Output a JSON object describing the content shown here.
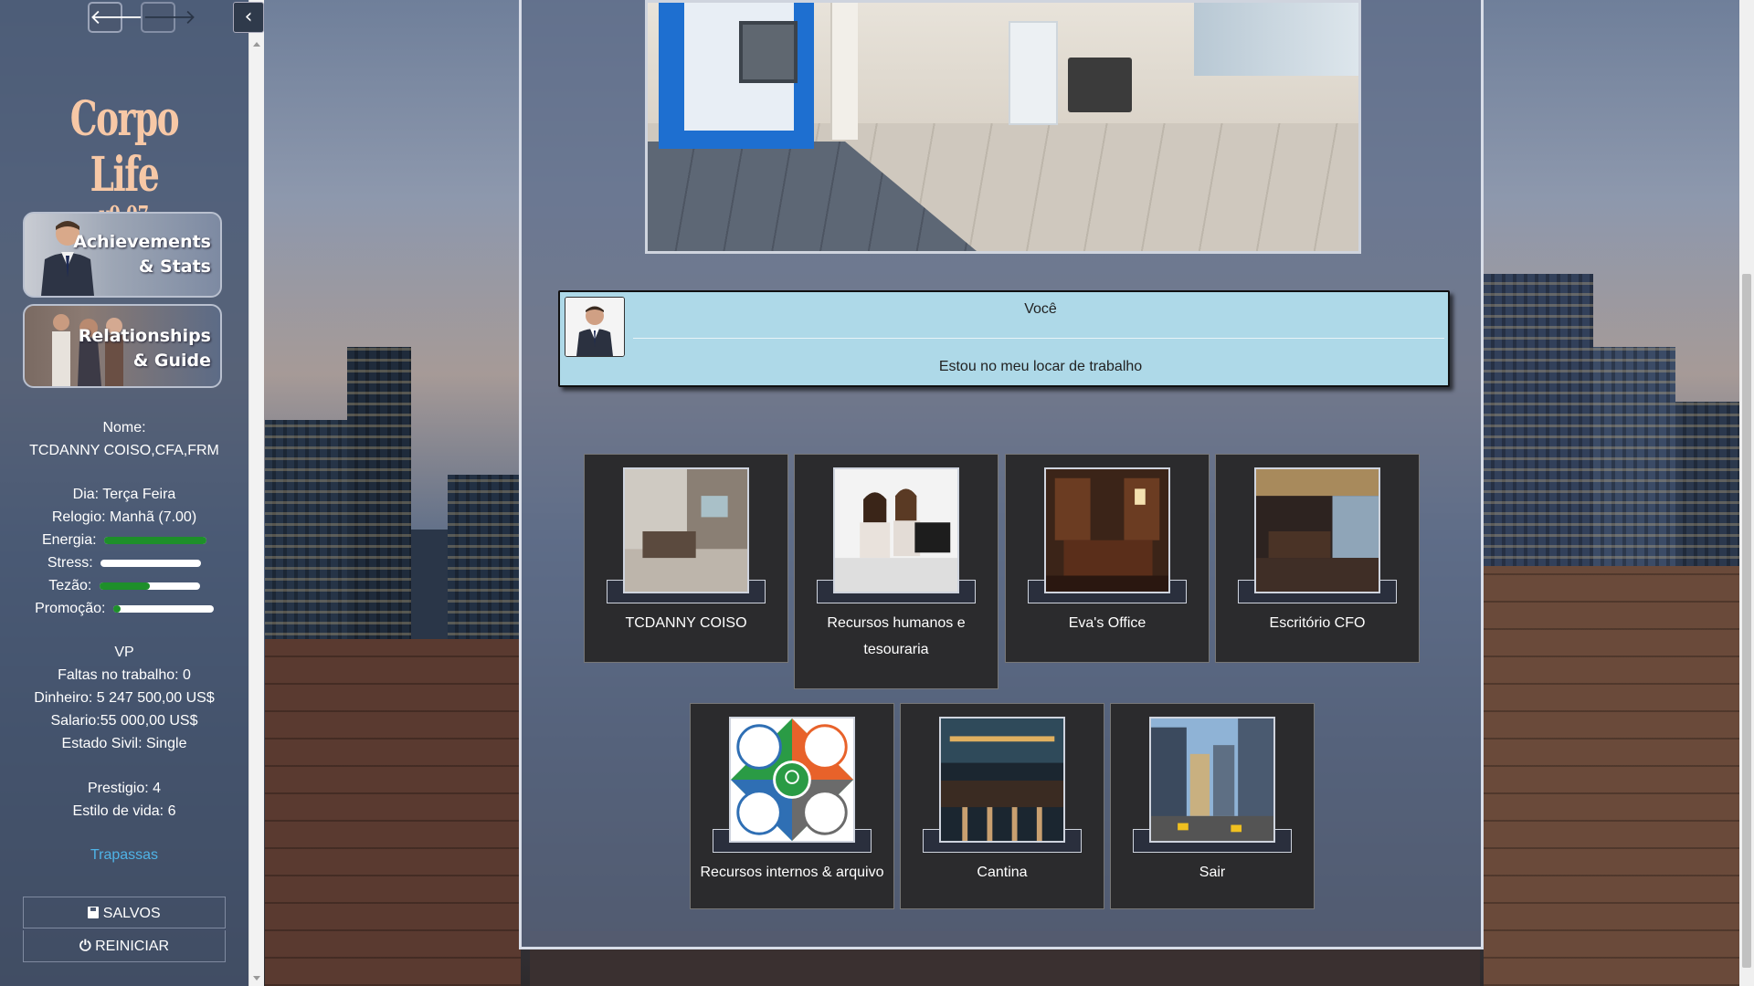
{
  "game": {
    "title": "Corpo Life",
    "version": "v0.07"
  },
  "sidebar": {
    "achievements_label_1": "Achievements",
    "achievements_label_2": "& Stats",
    "relationships_label_1": "Relationships",
    "relationships_label_2": "& Guide",
    "name_label": "Nome:",
    "name_value": "TCDANNY COISO,CFA,FRM",
    "day": "Dia: Terça Feira",
    "clock": "Relogio: Manhã (7.00)",
    "energy_label": "Energia:",
    "stress_label": "Stress:",
    "tesao_label": "Tezão:",
    "promo_label": "Promoção:",
    "energy_level": 1.0,
    "stress_level": 0.0,
    "tesao_level": 0.5,
    "promo_level": 0.07,
    "title_rank": "VP",
    "absences": "Faltas no trabalho: 0",
    "money": "Dinheiro: 5 247 500,00 US$",
    "salary": "Salario:55 000,00 US$",
    "civil": "Estado Sivil: Single",
    "prestige": "Prestigio: 4",
    "lifestyle": "Estilo de vida: 6",
    "cheats_link": "Trapassas",
    "saves_button": "SALVOS",
    "restart_button": "REINICIAR"
  },
  "dialog": {
    "speaker": "Você",
    "text": "Estou no meu locar de trabalho"
  },
  "locations": [
    {
      "name": "TCDANNY COISO"
    },
    {
      "name": "Recursos humanos e tesouraria"
    },
    {
      "name": "Eva's Office"
    },
    {
      "name": "Escritório CFO"
    },
    {
      "name": "Recursos internos & arquivo"
    },
    {
      "name": "Cantina"
    },
    {
      "name": "Sair"
    }
  ],
  "colors": {
    "bar_fill": "#1e8f2a",
    "dialog_bg": "#aed9e8",
    "logo": "#f7c8a6"
  }
}
